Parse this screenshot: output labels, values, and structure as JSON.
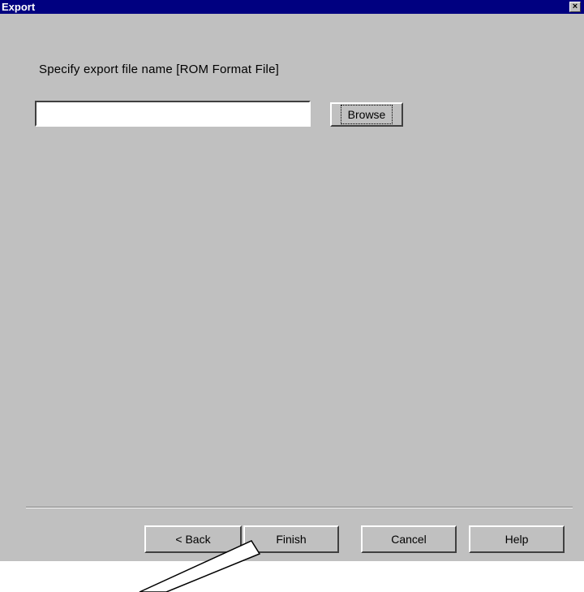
{
  "window": {
    "title": "Export",
    "close_glyph": "×"
  },
  "prompt": {
    "text": "Specify export file name [ROM Format File]"
  },
  "filename_input": {
    "value": "",
    "placeholder": ""
  },
  "buttons": {
    "browse": "Browse",
    "back": "< Back",
    "finish": "Finish",
    "cancel": "Cancel",
    "help": "Help"
  },
  "colors": {
    "titlebar": "#000080",
    "dialog_face": "#c0c0c0",
    "input_bg": "#ffffff"
  },
  "icons": {
    "close": "close-icon",
    "annotation": "callout-arrow-icon"
  }
}
